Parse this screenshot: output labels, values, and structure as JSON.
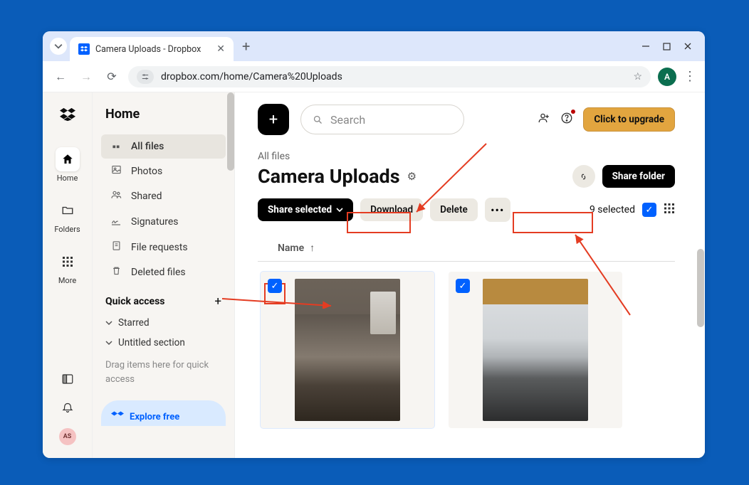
{
  "browser": {
    "tab_title": "Camera Uploads - Dropbox",
    "url_display": "dropbox.com/home/Camera%20Uploads",
    "avatar_letter": "A"
  },
  "rail": {
    "items": [
      {
        "label": "Home"
      },
      {
        "label": "Folders"
      },
      {
        "label": "More"
      }
    ],
    "user_initials": "AS"
  },
  "sidebar": {
    "title": "Home",
    "items": [
      {
        "label": "All files"
      },
      {
        "label": "Photos"
      },
      {
        "label": "Shared"
      },
      {
        "label": "Signatures"
      },
      {
        "label": "File requests"
      },
      {
        "label": "Deleted files"
      }
    ],
    "quick_access_title": "Quick access",
    "starred_label": "Starred",
    "untitled_label": "Untitled section",
    "hint": "Drag items here for quick access",
    "explore_label": "Explore free"
  },
  "main": {
    "search_placeholder": "Search",
    "upgrade_label": "Click to upgrade",
    "breadcrumb": "All files",
    "folder_name": "Camera Uploads",
    "share_folder_label": "Share folder",
    "share_selected_label": "Share selected",
    "download_label": "Download",
    "delete_label": "Delete",
    "selected_count_label": "9 selected",
    "name_header": "Name"
  },
  "annotation_boxes": [
    {
      "note": "download-button highlight"
    },
    {
      "note": "selected-count highlight"
    },
    {
      "note": "first-card-checkbox highlight"
    }
  ]
}
